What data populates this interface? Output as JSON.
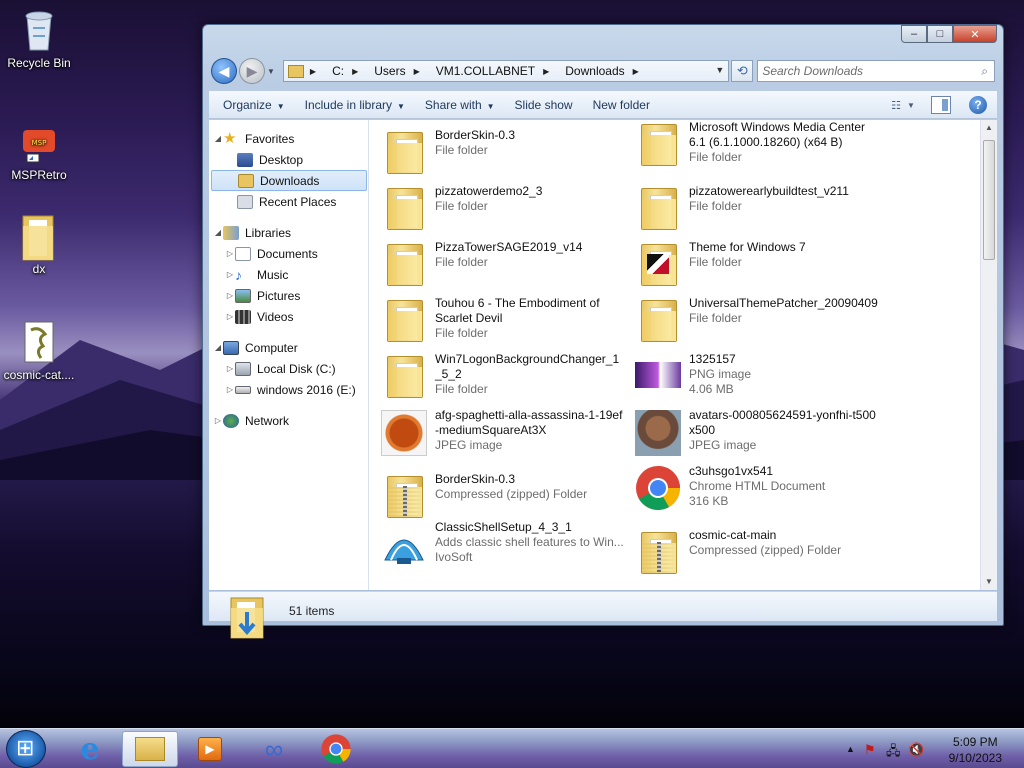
{
  "desktop": {
    "icons": [
      {
        "label": "Recycle Bin"
      },
      {
        "label": "MSPRetro"
      },
      {
        "label": "dx"
      },
      {
        "label": "cosmic-cat...."
      }
    ]
  },
  "window": {
    "caption": {
      "minimize": "–",
      "maximize": "□",
      "close": "✕"
    },
    "address": {
      "crumbs": [
        "C:",
        "Users",
        "VM1.COLLABNET",
        "Downloads"
      ]
    },
    "search": {
      "placeholder": "Search Downloads"
    },
    "toolbar": {
      "organize": "Organize",
      "include_in_library": "Include in library",
      "share_with": "Share with",
      "slide_show": "Slide show",
      "new_folder": "New folder"
    },
    "nav": {
      "favorites": "Favorites",
      "desktop": "Desktop",
      "downloads": "Downloads",
      "recent_places": "Recent Places",
      "libraries": "Libraries",
      "documents": "Documents",
      "music": "Music",
      "pictures": "Pictures",
      "videos": "Videos",
      "computer": "Computer",
      "local_disk": "Local Disk (C:)",
      "windows_drive": "windows 2016 (E:)",
      "network": "Network"
    },
    "files": [
      {
        "name": "BorderSkin-0.3",
        "sub1": "File folder",
        "sub2": "",
        "kind": "folder"
      },
      {
        "name": "Microsoft Windows Media Center 6.1 (6.1.1000.18260) (x64 B)",
        "sub1": "File folder",
        "sub2": "",
        "kind": "folder"
      },
      {
        "name": "pizzatowerdemo2_3",
        "sub1": "File folder",
        "sub2": "",
        "kind": "folder"
      },
      {
        "name": "pizzatowerearlybuildtest_v211",
        "sub1": "File folder",
        "sub2": "",
        "kind": "folder"
      },
      {
        "name": "PizzaTowerSAGE2019_v14",
        "sub1": "File folder",
        "sub2": "",
        "kind": "folder"
      },
      {
        "name": "Theme for Windows 7",
        "sub1": "File folder",
        "sub2": "",
        "kind": "folder-theme"
      },
      {
        "name": "Touhou 6  - The Embodiment of Scarlet Devil",
        "sub1": "File folder",
        "sub2": "",
        "kind": "folder"
      },
      {
        "name": "UniversalThemePatcher_20090409",
        "sub1": "File folder",
        "sub2": "",
        "kind": "folder"
      },
      {
        "name": "Win7LogonBackgroundChanger_1_5_2",
        "sub1": "File folder",
        "sub2": "",
        "kind": "folder"
      },
      {
        "name": "1325157",
        "sub1": "PNG image",
        "sub2": "4.06 MB",
        "kind": "png"
      },
      {
        "name": "afg-spaghetti-alla-assassina-1-19ef-mediumSquareAt3X",
        "sub1": "JPEG image",
        "sub2": "",
        "kind": "jpeg-food"
      },
      {
        "name": "avatars-000805624591-yonfhi-t500x500",
        "sub1": "JPEG image",
        "sub2": "",
        "kind": "jpeg-avatar"
      },
      {
        "name": "BorderSkin-0.3",
        "sub1": "Compressed (zipped) Folder",
        "sub2": "",
        "kind": "zip"
      },
      {
        "name": "c3uhsgo1vx541",
        "sub1": "Chrome HTML Document",
        "sub2": "316 KB",
        "kind": "chrome"
      },
      {
        "name": "ClassicShellSetup_4_3_1",
        "sub1": "Adds classic shell features to Win...",
        "sub2": "IvoSoft",
        "kind": "shell"
      },
      {
        "name": "cosmic-cat-main",
        "sub1": "Compressed (zipped) Folder",
        "sub2": "",
        "kind": "zip"
      }
    ],
    "status": {
      "count": "51 items"
    }
  },
  "taskbar": {
    "clock_time": "5:09 PM",
    "clock_date": "9/10/2023",
    "tray_arrow": "▲"
  },
  "colors": {
    "accent": "#3b6ca8",
    "selection": "#cfe2f8"
  }
}
